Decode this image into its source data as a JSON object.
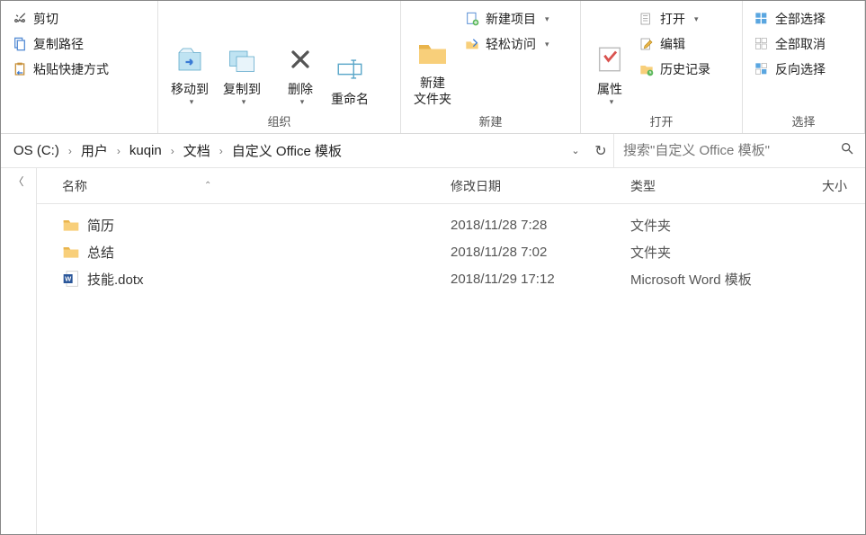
{
  "ribbon": {
    "clipboard": {
      "cut": "剪切",
      "copy_path": "复制路径",
      "paste_shortcut": "粘贴快捷方式"
    },
    "organize": {
      "label": "组织",
      "move_to": "移动到",
      "copy_to": "复制到",
      "delete": "删除",
      "rename": "重命名"
    },
    "new": {
      "label": "新建",
      "new_folder_l1": "新建",
      "new_folder_l2": "文件夹",
      "new_item": "新建项目",
      "easy_access": "轻松访问"
    },
    "open": {
      "label": "打开",
      "properties": "属性",
      "open": "打开",
      "edit": "编辑",
      "history": "历史记录"
    },
    "select": {
      "label": "选择",
      "select_all": "全部选择",
      "select_none": "全部取消",
      "invert": "反向选择"
    }
  },
  "breadcrumb": {
    "parts": [
      "OS (C:)",
      "用户",
      "kuqin",
      "文档",
      "自定义 Office 模板"
    ]
  },
  "search": {
    "placeholder": "搜索\"自定义 Office 模板\""
  },
  "columns": {
    "name": "名称",
    "modified": "修改日期",
    "type": "类型",
    "size": "大小"
  },
  "rows": [
    {
      "icon": "folder",
      "name": "简历",
      "modified": "2018/11/28 7:28",
      "type": "文件夹"
    },
    {
      "icon": "folder",
      "name": "总结",
      "modified": "2018/11/28 7:02",
      "type": "文件夹"
    },
    {
      "icon": "word",
      "name": "技能.dotx",
      "modified": "2018/11/29 17:12",
      "type": "Microsoft Word 模板"
    }
  ]
}
